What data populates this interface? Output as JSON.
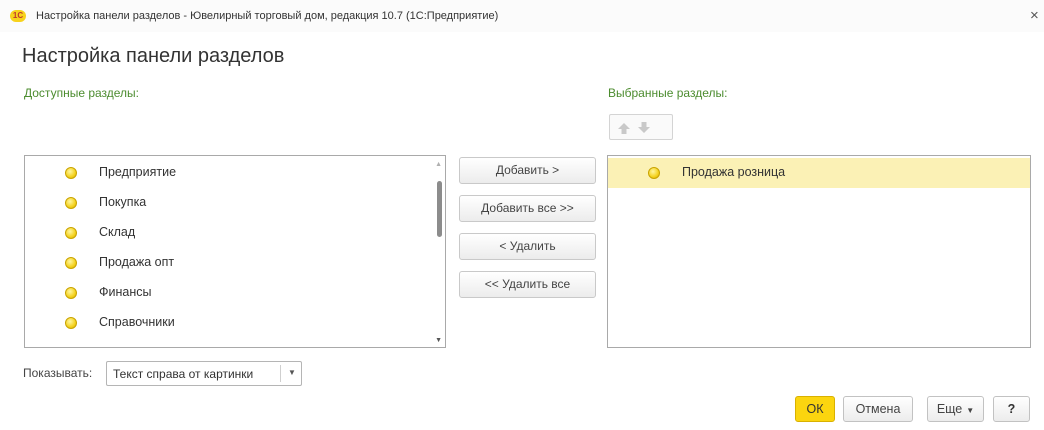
{
  "window": {
    "logo_text": "1С",
    "title": "Настройка панели разделов - Ювелирный торговый дом, редакция 10.7  (1С:Предприятие)",
    "close_glyph": "×"
  },
  "form": {
    "title": "Настройка панели разделов",
    "available_label": "Доступные разделы:",
    "selected_label": "Выбранные разделы:"
  },
  "available_sections": [
    {
      "label": "Предприятие",
      "icon": "yellow-circle-icon"
    },
    {
      "label": "Покупка",
      "icon": "yellow-circle-icon"
    },
    {
      "label": "Склад",
      "icon": "yellow-circle-icon"
    },
    {
      "label": "Продажа опт",
      "icon": "yellow-circle-icon"
    },
    {
      "label": "Финансы",
      "icon": "yellow-circle-icon"
    },
    {
      "label": "Справочники",
      "icon": "yellow-circle-icon"
    }
  ],
  "selected_sections": [
    {
      "label": "Продажа розница",
      "icon": "yellow-circle-icon",
      "selected": true
    }
  ],
  "buttons": {
    "add": "Добавить >",
    "add_all": "Добавить все >>",
    "remove": "< Удалить",
    "remove_all": "<< Удалить все",
    "ok": "ОК",
    "cancel": "Отмена",
    "more": "Еще",
    "help": "?"
  },
  "show": {
    "label": "Показывать:",
    "value": "Текст справа от картинки"
  },
  "colors": {
    "accent_green": "#4c8c2f",
    "ok_yellow": "#fbd50f",
    "selected_row": "#fbf1b5"
  }
}
